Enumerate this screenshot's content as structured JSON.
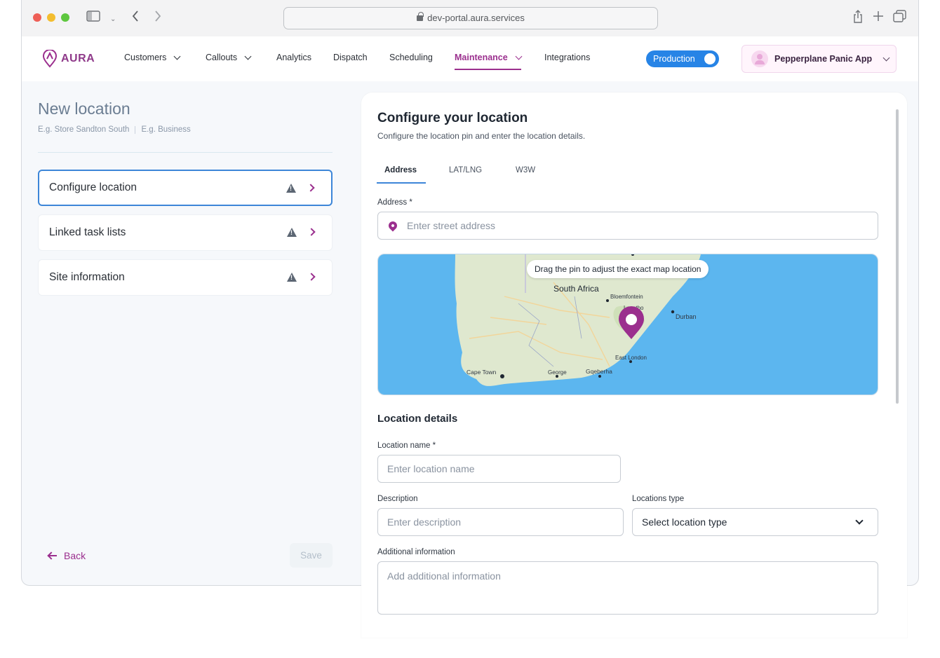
{
  "browser": {
    "url": "dev-portal.aura.services"
  },
  "nav": {
    "logo_text": "AURA",
    "items": [
      {
        "label": "Customers",
        "has_menu": true
      },
      {
        "label": "Callouts",
        "has_menu": true
      },
      {
        "label": "Analytics",
        "has_menu": false
      },
      {
        "label": "Dispatch",
        "has_menu": false
      },
      {
        "label": "Scheduling",
        "has_menu": false
      },
      {
        "label": "Maintenance",
        "has_menu": true,
        "active": true
      },
      {
        "label": "Integrations",
        "has_menu": false
      }
    ],
    "environment_toggle": {
      "label": "Production",
      "on": true
    },
    "app_selector": {
      "label": "Pepperplane Panic App"
    }
  },
  "left": {
    "title": "New location",
    "subtitle_parts": [
      "E.g. Store Sandton South",
      "E.g. Business"
    ],
    "steps": [
      {
        "label": "Configure location",
        "active": true,
        "warning": true
      },
      {
        "label": "Linked task lists",
        "active": false,
        "warning": true
      },
      {
        "label": "Site information",
        "active": false,
        "warning": true
      }
    ],
    "back_label": "Back",
    "save_label": "Save"
  },
  "card": {
    "title": "Configure your location",
    "subtitle": "Configure the location pin and enter the location details.",
    "tabs": [
      {
        "label": "Address",
        "active": true
      },
      {
        "label": "LAT/LNG",
        "active": false
      },
      {
        "label": "W3W",
        "active": false
      }
    ],
    "address": {
      "label": "Address *",
      "placeholder": "Enter street address"
    },
    "map": {
      "tip": "Drag the pin to adjust the exact map location",
      "labels": {
        "country": "South Africa",
        "bloemfontein": "Bloemfontein",
        "lesotho": "Lesotho",
        "durban": "Durban",
        "east_london": "East London",
        "cape_town": "Cape Town",
        "george": "George",
        "gqeberha": "Gqeberha"
      }
    },
    "details": {
      "title": "Location details",
      "name_label": "Location name *",
      "name_placeholder": "Enter location name",
      "description_label": "Description",
      "description_placeholder": "Enter description",
      "type_label": "Locations type",
      "type_placeholder": "Select location type",
      "additional_label": "Additional information",
      "additional_placeholder": "Add additional information"
    }
  },
  "colors": {
    "brand": "#9b2f8e",
    "accent_blue": "#3d86d8",
    "toggle_blue": "#2784e6",
    "map_water": "#5cb6ef",
    "map_land": "#dfe8cf"
  }
}
